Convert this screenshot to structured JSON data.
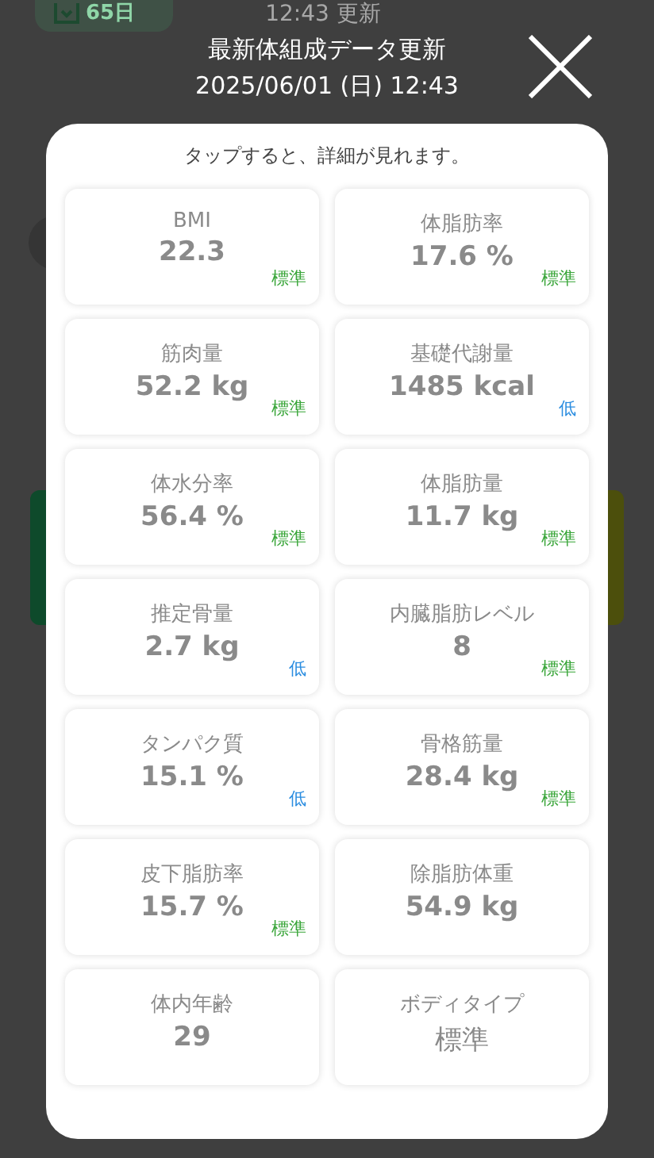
{
  "background": {
    "badge": "65日",
    "updated": "12:43 更新"
  },
  "dialog": {
    "title": "最新体組成データ更新",
    "datetime": "2025/06/01 (日) 12:43",
    "hint": "タップすると、詳細が見れます。",
    "rows": [
      {
        "cells": [
          {
            "label": "BMI",
            "value": "22.3",
            "status": "標準",
            "color": "#3aa63a"
          },
          {
            "label": "体脂肪率",
            "value": "17.6 %",
            "status": "標準",
            "color": "#3aa63a"
          }
        ]
      },
      {
        "cells": [
          {
            "label": "筋肉量",
            "value": "52.2 kg",
            "status": "標準",
            "color": "#3aa63a"
          },
          {
            "label": "基礎代謝量",
            "value": "1485 kcal",
            "status": "低",
            "color": "#2b8de0"
          }
        ]
      },
      {
        "cells": [
          {
            "label": "体水分率",
            "value": "56.4 %",
            "status": "標準",
            "color": "#3aa63a"
          },
          {
            "label": "体脂肪量",
            "value": "11.7 kg",
            "status": "標準",
            "color": "#3aa63a"
          }
        ]
      },
      {
        "cells": [
          {
            "label": "推定骨量",
            "value": "2.7 kg",
            "status": "低",
            "color": "#2b8de0"
          },
          {
            "label": "内臓脂肪レベル",
            "value": "8",
            "status": "標準",
            "color": "#3aa63a"
          }
        ]
      },
      {
        "cells": [
          {
            "label": "タンパク質",
            "value": "15.1 %",
            "status": "低",
            "color": "#2b8de0"
          },
          {
            "label": "骨格筋量",
            "value": "28.4 kg",
            "status": "標準",
            "color": "#3aa63a"
          }
        ]
      },
      {
        "cells": [
          {
            "label": "皮下脂肪率",
            "value": "15.7 %",
            "status": "標準",
            "color": "#3aa63a"
          },
          {
            "label": "除脂肪体重",
            "value": "54.9 kg"
          }
        ]
      },
      {
        "cells": [
          {
            "label": "体内年齢",
            "value": "29"
          },
          {
            "label": "ボディタイプ",
            "value": "標準",
            "kind": "text"
          }
        ]
      }
    ]
  }
}
